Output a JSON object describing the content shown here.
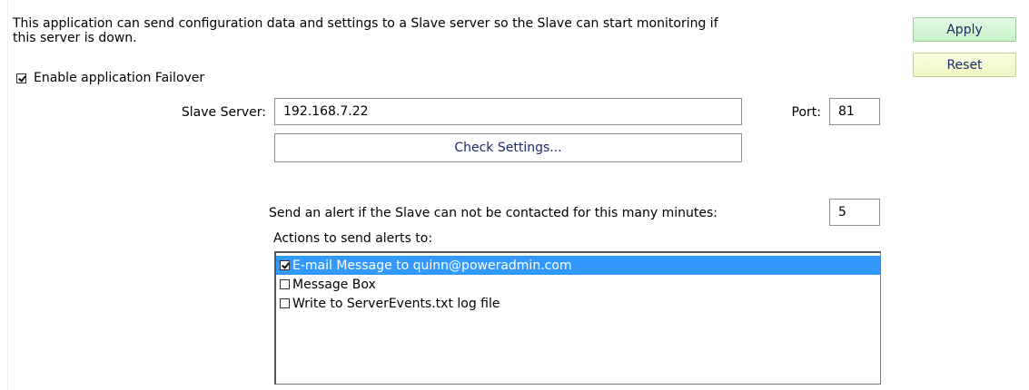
{
  "description": {
    "line1": "This application can send configuration data and settings to a Slave server so the Slave can start monitoring if",
    "line2": "this server is down."
  },
  "buttons": {
    "apply_label": "Apply",
    "reset_label": "Reset",
    "check_settings_label": "Check Settings..."
  },
  "failover": {
    "label": "Enable application Failover",
    "checked": true
  },
  "slave": {
    "label": "Slave Server:",
    "value": "192.168.7.22"
  },
  "port": {
    "label": "Port:",
    "value": "81"
  },
  "alert": {
    "label": "Send an alert if the Slave can not be contacted for this many minutes:",
    "minutes": "5"
  },
  "actions": {
    "label": "Actions to send alerts to:",
    "items": [
      {
        "label": "E-mail Message to quinn@poweradmin.com",
        "checked": true,
        "selected": true
      },
      {
        "label": "Message Box",
        "checked": false,
        "selected": false
      },
      {
        "label": "Write to ServerEvents.txt log file",
        "checked": false,
        "selected": false
      }
    ]
  },
  "colors": {
    "selection": "#3399ff",
    "apply_bg": "#d4f7d4",
    "reset_bg": "#f5f9d2",
    "button_text": "#1a2a6c"
  }
}
